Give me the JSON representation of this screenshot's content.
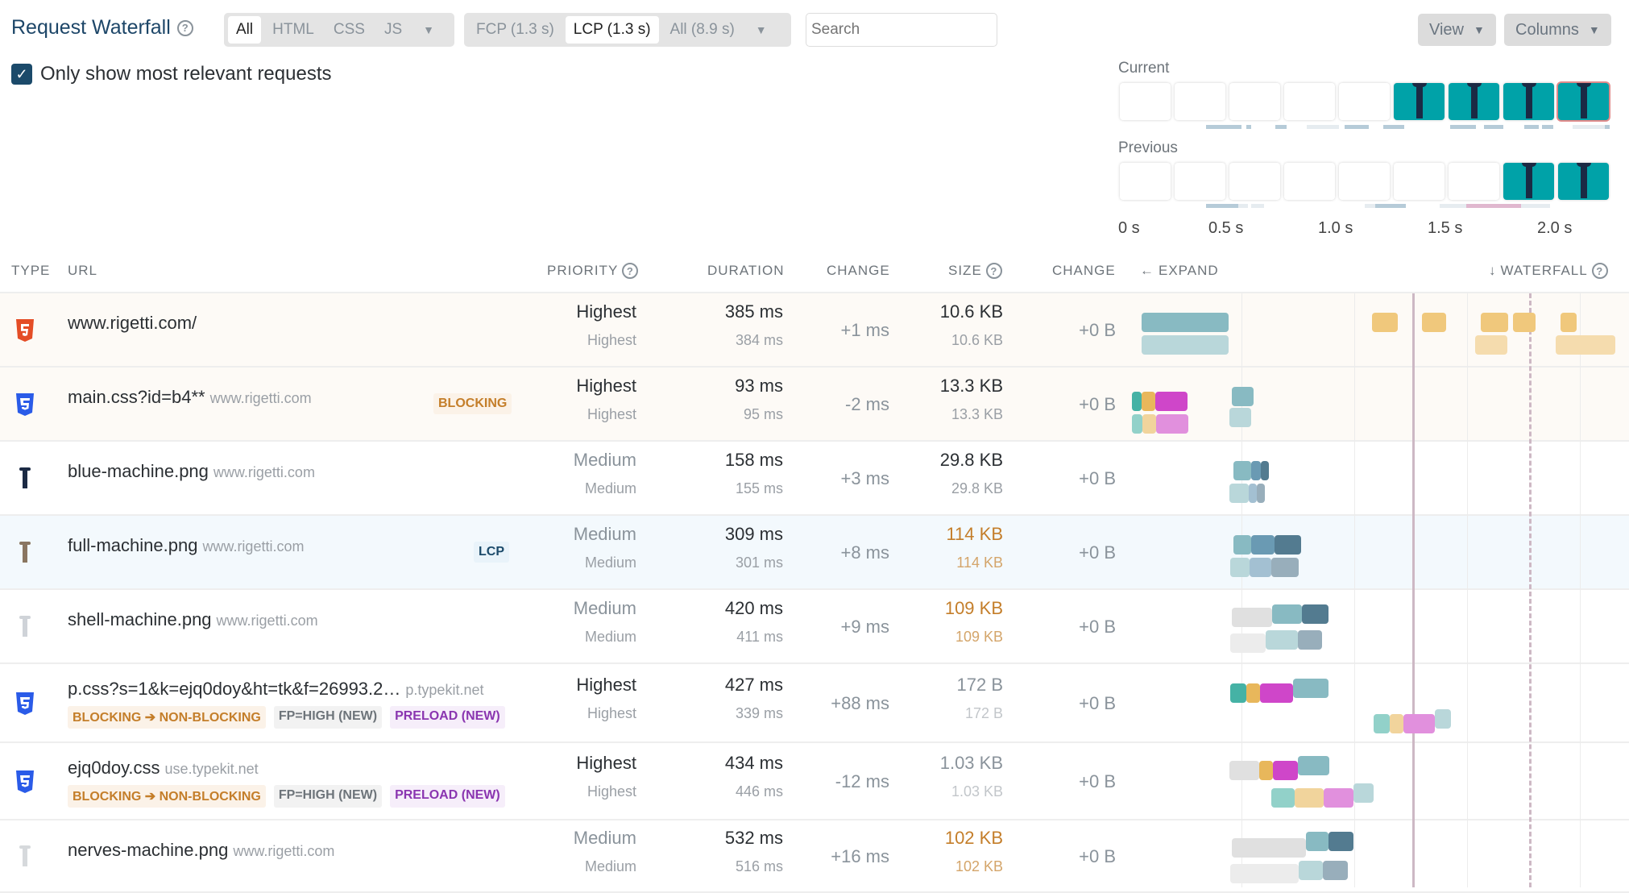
{
  "header": {
    "title": "Request Waterfall",
    "help_icon": "question-circle-icon",
    "type_filter": [
      "All",
      "HTML",
      "CSS",
      "JS"
    ],
    "type_filter_active": "All",
    "metric_filter": [
      "FCP (1.3 s)",
      "LCP (1.3 s)",
      "All (8.9 s)"
    ],
    "metric_filter_active": "LCP (1.3 s)",
    "search_placeholder": "Search",
    "view_label": "View",
    "columns_label": "Columns",
    "relevant_checkbox_label": "Only show most relevant requests",
    "relevant_checked": true
  },
  "filmstrip": {
    "current_label": "Current",
    "previous_label": "Previous",
    "current_frames": [
      "blank",
      "blank",
      "blank",
      "blank",
      "blank",
      "page",
      "page",
      "page",
      "page-lcp"
    ],
    "previous_frames": [
      "blank",
      "blank",
      "blank",
      "blank",
      "blank",
      "blank",
      "blank",
      "page",
      "page"
    ],
    "axis_ticks": [
      "0 s",
      "0.5 s",
      "1.0 s",
      "1.5 s",
      "2.0 s"
    ]
  },
  "table": {
    "columns": {
      "type": "TYPE",
      "url": "URL",
      "priority": "PRIORITY",
      "duration": "DURATION",
      "change": "CHANGE",
      "size": "SIZE",
      "size_change": "CHANGE",
      "expand": "EXPAND",
      "waterfall": "WATERFALL"
    },
    "rows": [
      {
        "type": "html",
        "url": "www.rigetti.com/",
        "host": "",
        "badge": "",
        "priority": "Highest",
        "priority_prev": "Highest",
        "duration": "385 ms",
        "duration_prev": "384 ms",
        "change": "+1 ms",
        "size": "10.6 KB",
        "size_prev": "10.6 KB",
        "size_change": "+0 B"
      },
      {
        "type": "css",
        "url": "main.css?id=b4**",
        "host": "www.rigetti.com",
        "badge": "BLOCKING",
        "priority": "Highest",
        "priority_prev": "Highest",
        "duration": "93 ms",
        "duration_prev": "95 ms",
        "change": "-2 ms",
        "size": "13.3 KB",
        "size_prev": "13.3 KB",
        "size_change": "+0 B"
      },
      {
        "type": "image",
        "url": "blue-machine.png",
        "host": "www.rigetti.com",
        "badge": "",
        "priority": "Medium",
        "priority_prev": "Medium",
        "duration": "158 ms",
        "duration_prev": "155 ms",
        "change": "+3 ms",
        "size": "29.8 KB",
        "size_prev": "29.8 KB",
        "size_change": "+0 B"
      },
      {
        "type": "image",
        "url": "full-machine.png",
        "host": "www.rigetti.com",
        "badge": "LCP",
        "priority": "Medium",
        "priority_prev": "Medium",
        "duration": "309 ms",
        "duration_prev": "301 ms",
        "change": "+8 ms",
        "size": "114 KB",
        "size_prev": "114 KB",
        "size_change": "+0 B"
      },
      {
        "type": "image",
        "url": "shell-machine.png",
        "host": "www.rigetti.com",
        "badge": "",
        "priority": "Medium",
        "priority_prev": "Medium",
        "duration": "420 ms",
        "duration_prev": "411 ms",
        "change": "+9 ms",
        "size": "109 KB",
        "size_prev": "109 KB",
        "size_change": "+0 B"
      },
      {
        "type": "css",
        "url": "p.css?s=1&k=ejq0doy&ht=tk&f=26993.2…",
        "host": "p.typekit.net",
        "tags": [
          "BLOCKING ➔ NON-BLOCKING",
          "FP=HIGH (NEW)",
          "PRELOAD (NEW)"
        ],
        "priority": "Highest",
        "priority_prev": "Highest",
        "duration": "427 ms",
        "duration_prev": "339 ms",
        "change": "+88 ms",
        "size": "172 B",
        "size_prev": "172 B",
        "size_change": "+0 B"
      },
      {
        "type": "css",
        "url": "ejq0doy.css",
        "host": "use.typekit.net",
        "tags": [
          "BLOCKING ➔ NON-BLOCKING",
          "FP=HIGH (NEW)",
          "PRELOAD (NEW)"
        ],
        "priority": "Highest",
        "priority_prev": "Highest",
        "duration": "434 ms",
        "duration_prev": "446 ms",
        "change": "-12 ms",
        "size": "1.03 KB",
        "size_prev": "1.03 KB",
        "size_change": "+0 B"
      },
      {
        "type": "image",
        "url": "nerves-machine.png",
        "host": "www.rigetti.com",
        "badge": "",
        "priority": "Medium",
        "priority_prev": "Medium",
        "duration": "532 ms",
        "duration_prev": "516 ms",
        "change": "+16 ms",
        "size": "102 KB",
        "size_prev": "102 KB",
        "size_change": "+0 B"
      }
    ]
  },
  "colors": {
    "title": "#1d4668",
    "blocking": "#c47e2a",
    "lcp_badge": "#1b4a6a",
    "preload": "#8a35b0",
    "html_icon": "#e44d26",
    "css_icon": "#2a5be8",
    "frame_teal": "#00a2a8"
  }
}
